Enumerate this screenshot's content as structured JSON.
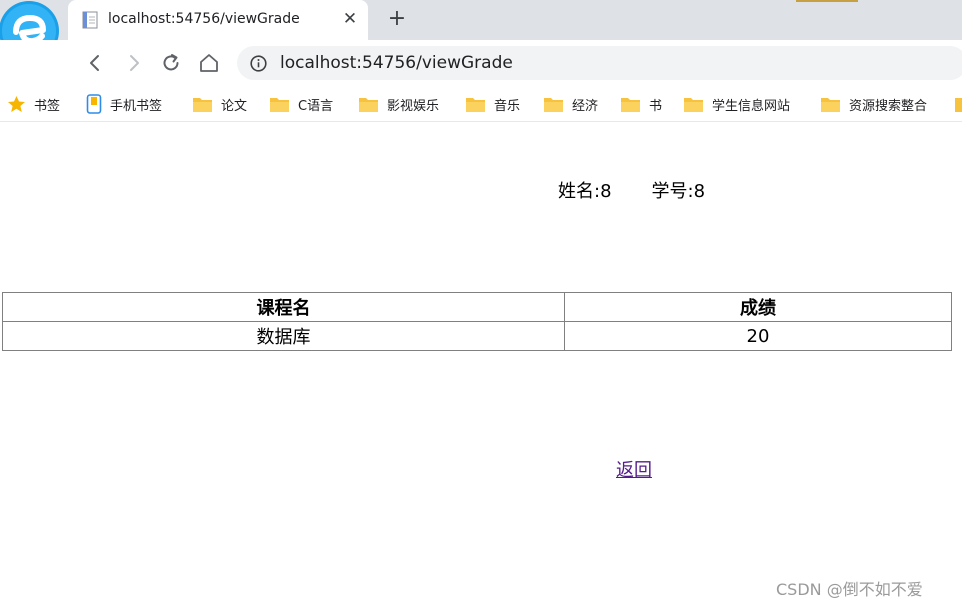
{
  "browser": {
    "tab": {
      "title": "localhost:54756/viewGrade",
      "close_glyph": "✕"
    },
    "new_tab_glyph": "+",
    "address": "localhost:54756/viewGrade",
    "nav_icons": [
      "back-icon",
      "forward-icon",
      "reload-icon",
      "home-icon",
      "site-info-icon"
    ]
  },
  "bookmarks": [
    {
      "label": "书签",
      "icon": "star-icon"
    },
    {
      "label": "手机书签",
      "icon": "phone-bookmark-icon"
    },
    {
      "label": "论文",
      "icon": "folder-icon"
    },
    {
      "label": "C语言",
      "icon": "folder-icon"
    },
    {
      "label": "影视娱乐",
      "icon": "folder-icon"
    },
    {
      "label": "音乐",
      "icon": "folder-icon"
    },
    {
      "label": "经济",
      "icon": "folder-icon"
    },
    {
      "label": "书",
      "icon": "folder-icon"
    },
    {
      "label": "学生信息网站",
      "icon": "folder-icon"
    },
    {
      "label": "资源搜索整合",
      "icon": "folder-icon"
    }
  ],
  "student": {
    "name_text": "姓名:8",
    "id_text": "学号:8"
  },
  "grades": {
    "headers": [
      "课程名",
      "成绩"
    ],
    "rows": [
      [
        "数据库",
        "20"
      ]
    ]
  },
  "back_link": "返回",
  "watermark": "CSDN @倒不如不爱",
  "colors": {
    "tab_strip": "#dee1e6",
    "omnibox": "#f1f3f4",
    "folder": "#f7c33e",
    "visited_link": "#551a8b"
  }
}
